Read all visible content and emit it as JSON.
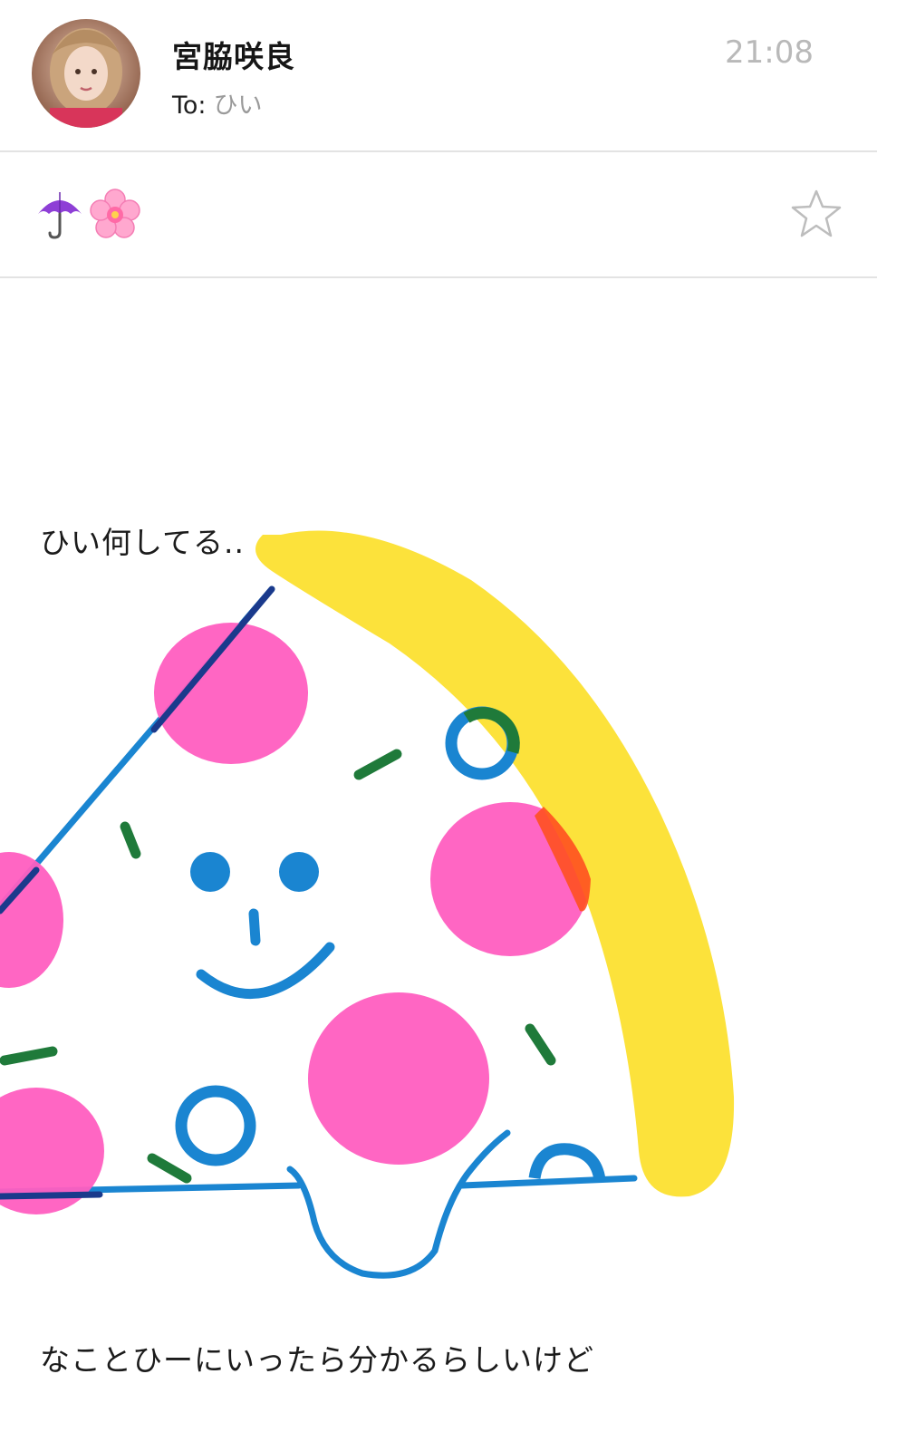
{
  "header": {
    "sender_name": "宮脇咲良",
    "to_label": "To:",
    "to_value": "ひい",
    "time": "21:08"
  },
  "subject": {
    "emojis": [
      "umbrella-icon",
      "cherry-blossom-icon"
    ]
  },
  "body": {
    "line1": "ひい何してる..",
    "line2": "なことひーにいったら分かるらしいけど"
  },
  "colors": {
    "divider": "#e3e3e3",
    "time_text": "#b9b9b9",
    "pizza_crust": "#fce23b",
    "pizza_outline": "#1a85d1",
    "pepperoni": "#ff5ec0",
    "herb": "#1f7a3a"
  }
}
